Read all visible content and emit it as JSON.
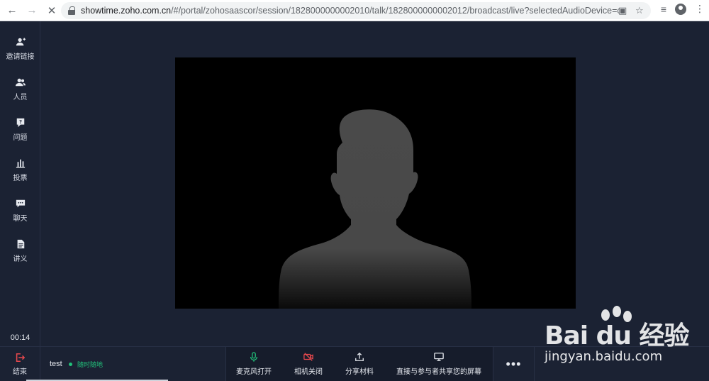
{
  "browser": {
    "url_domain": "showtime.zoho.com.cn",
    "url_rest": "/#/portal/zohosaascor/session/1828000000002010/talk/1828000000002012/broadcast/live?selectedAudioDevice=co..."
  },
  "sidebar": {
    "items": [
      {
        "label": "邀请链接",
        "icon": "user-add-icon"
      },
      {
        "label": "人员",
        "icon": "people-icon"
      },
      {
        "label": "问题",
        "icon": "question-icon"
      },
      {
        "label": "投票",
        "icon": "poll-icon"
      },
      {
        "label": "聊天",
        "icon": "chat-icon"
      },
      {
        "label": "讲义",
        "icon": "handout-icon"
      }
    ],
    "timer": "00:14",
    "leave_label": "结束"
  },
  "presenter": {
    "name": "test",
    "status": "随时随地"
  },
  "controls": {
    "mic": "麦克风打开",
    "camera": "相机关闭",
    "share_material": "分享材料",
    "share_screen": "直接与参与者共享您的屏幕",
    "more": "•••"
  },
  "colors": {
    "background": "#1b2233",
    "accent_green": "#21c17a",
    "danger_red": "#e5484d"
  },
  "watermark": {
    "brand": "Bai du 经验",
    "url": "jingyan.baidu.com"
  }
}
